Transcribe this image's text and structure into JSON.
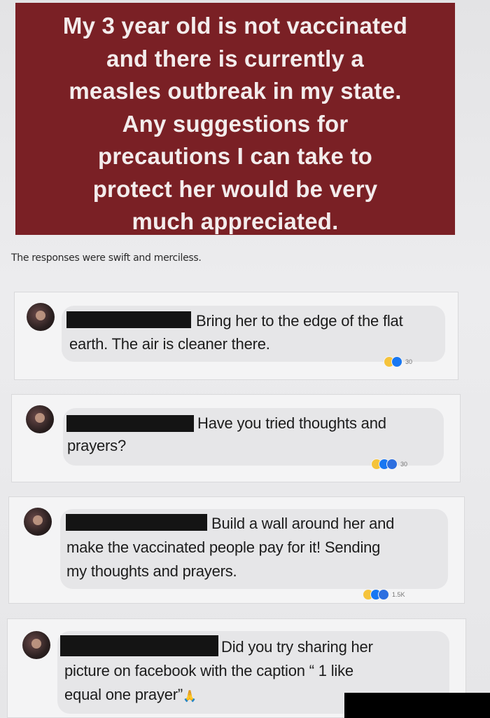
{
  "banner": {
    "lines": [
      "My 3 year old is not vaccinated",
      "and there is currently a",
      "measles outbreak in my state.",
      "Any suggestions for",
      "precautions I can take to",
      "protect her would be very",
      "much appreciated."
    ]
  },
  "caption": "The responses were swift and merciless.",
  "comments": [
    {
      "line1": "Bring her to the edge of the flat",
      "line2": "earth. The air is cleaner there.",
      "count": "30"
    },
    {
      "line1": "Have you tried thoughts and",
      "line2": "prayers?",
      "count": "30"
    },
    {
      "line1": "Build a wall around her and",
      "line2": "make the vaccinated people pay for it! Sending",
      "line3": "my thoughts and prayers.",
      "count": "1.5K"
    },
    {
      "line1": "Did you try sharing her",
      "line2": "picture on facebook with the caption “ 1 like",
      "line3": "equal one prayer”",
      "emoji": "🙏"
    }
  ]
}
